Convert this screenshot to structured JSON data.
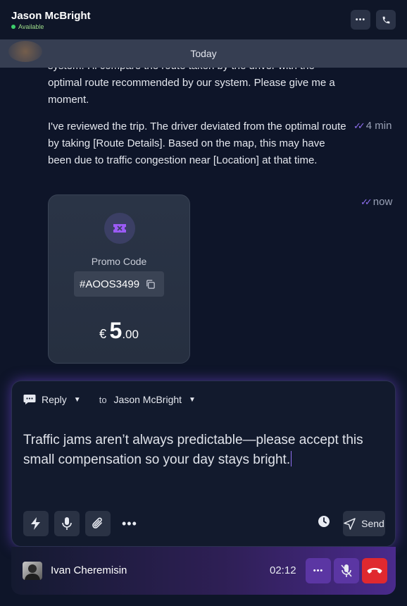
{
  "header": {
    "contact_name": "Jason McBright",
    "status": "Available",
    "more_label": "•••",
    "icons": [
      "more-icon",
      "phone-icon"
    ]
  },
  "date_divider": "Today",
  "messages": [
    {
      "text": "system. I'll compare the route taken by the driver with the optimal route recommended by our system. Please give me a moment."
    },
    {
      "text": "I've reviewed the trip. The driver deviated from the optimal route by taking [Route Details]. Based on the map, this may have been due to traffic congestion near [Location] at that time.",
      "time": "4 min"
    }
  ],
  "promo": {
    "time": "now",
    "label": "Promo Code",
    "code": "#AOOS3499",
    "currency": "€",
    "amount_int": "5",
    "amount_dec": ".00"
  },
  "composer": {
    "reply_label": "Reply",
    "to_label": "to",
    "recipient": "Jason McBright",
    "text": "Traffic jams aren’t always predictable—please accept this small compensation so your day stays bright.",
    "more_label": "•••",
    "send_label": "Send",
    "accent_color": "#8f6ff0"
  },
  "call": {
    "caller_name": "Ivan Cheremisin",
    "duration": "02:12",
    "more_label": "•••",
    "end_color": "#e0292f"
  }
}
